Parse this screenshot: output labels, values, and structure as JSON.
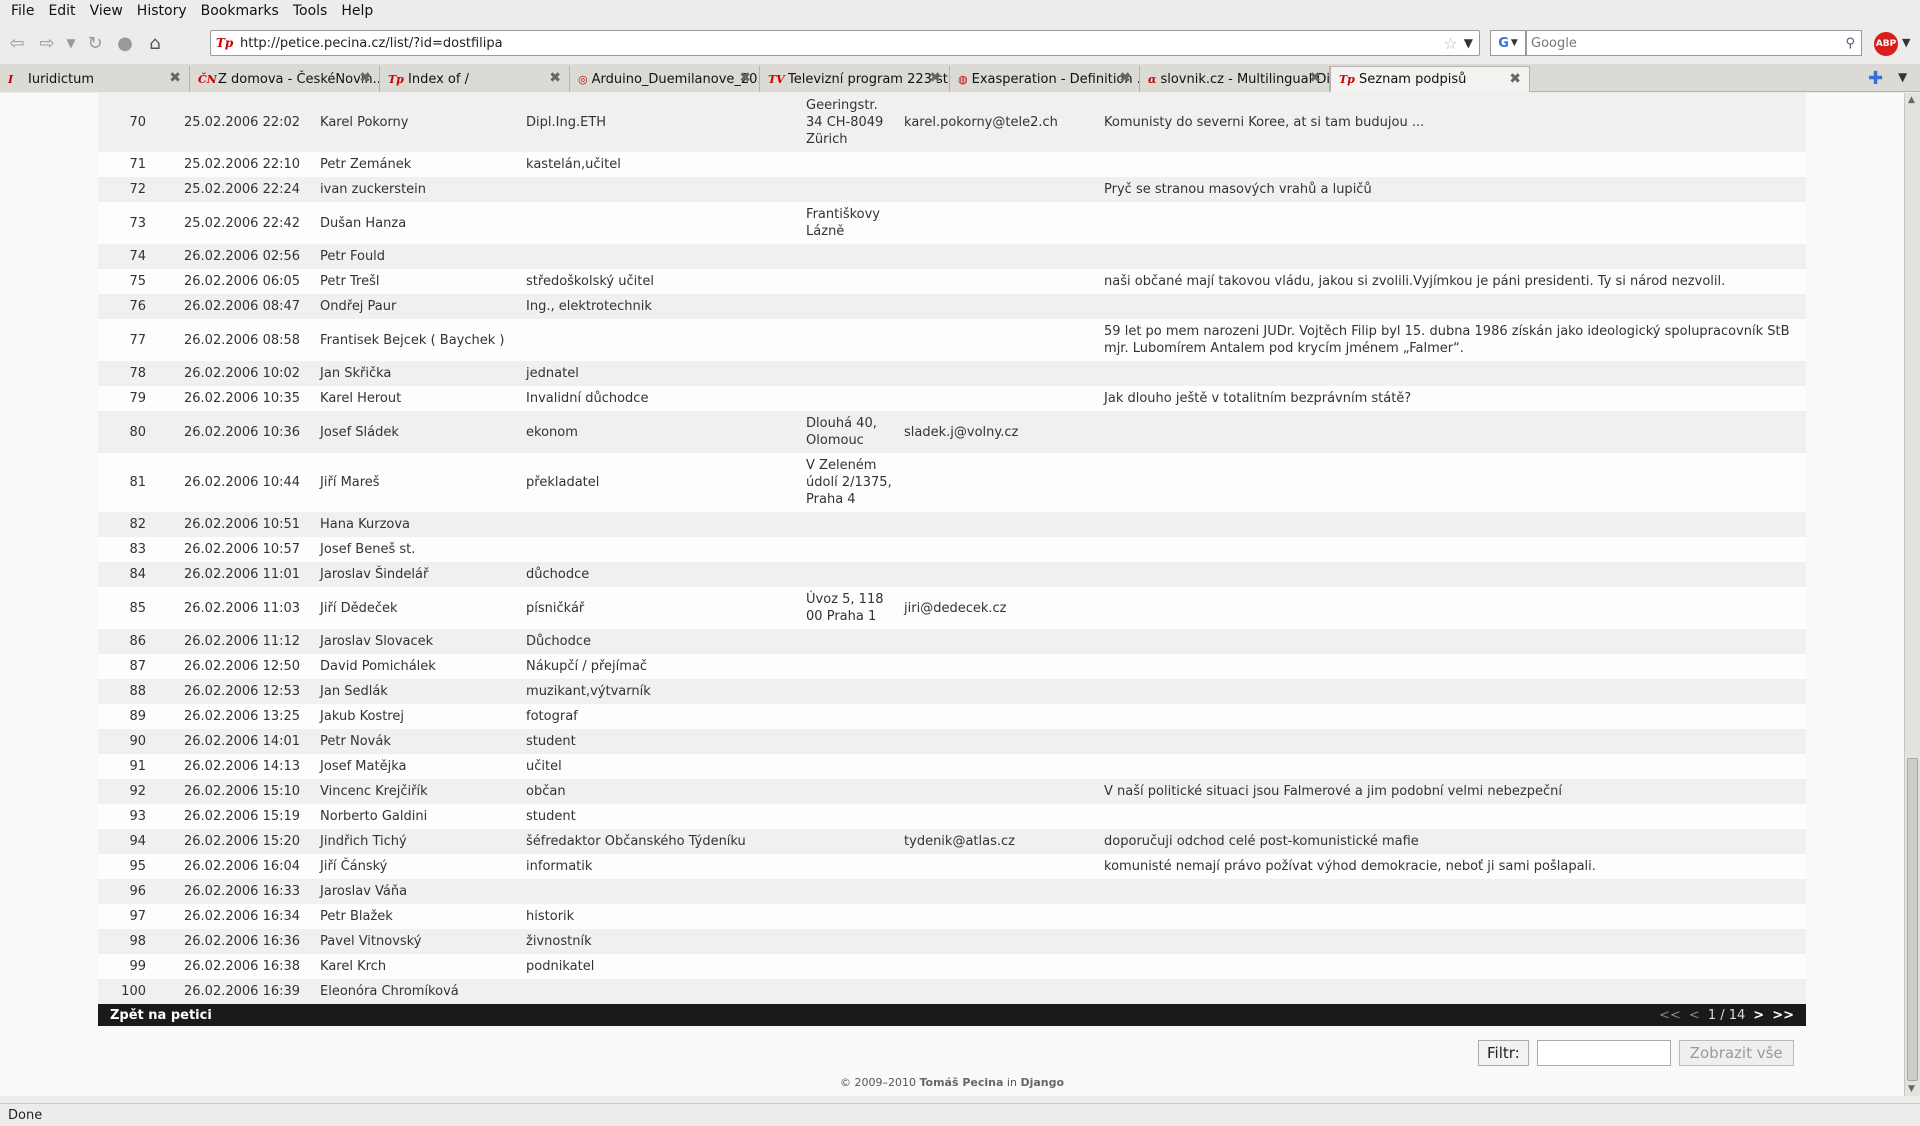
{
  "menu": [
    "File",
    "Edit",
    "View",
    "History",
    "Bookmarks",
    "Tools",
    "Help"
  ],
  "nav": {
    "url": "http://petice.pecina.cz/list/?id=dostfilipa",
    "search_placeholder": "Google",
    "abp_label": "ABP",
    "engine_label": "G"
  },
  "tabs": [
    {
      "title": "Iuridictum",
      "icon": "iuridictum-icon",
      "glyph": "I"
    },
    {
      "title": "Z domova - ČeskéNovin...",
      "icon": "ceskenoviny-icon",
      "glyph": "ČN"
    },
    {
      "title": "Index of /",
      "icon": "tp-icon",
      "glyph": "Tp"
    },
    {
      "title": "Arduino_Duemilanove_20...",
      "icon": "page-icon",
      "glyph": "◎"
    },
    {
      "title": "Televizní program 223 st...",
      "icon": "tv-icon",
      "glyph": "TV"
    },
    {
      "title": "Exasperation - Definition ...",
      "icon": "dictionary-icon",
      "glyph": "◍"
    },
    {
      "title": "slovnik.cz - Multilingual Di...",
      "icon": "slovnik-icon",
      "glyph": "α"
    },
    {
      "title": "Seznam podpisů",
      "icon": "tp-icon",
      "glyph": "Tp",
      "active": true
    }
  ],
  "rows": [
    {
      "num": "70",
      "date": "25.02.2006 22:02",
      "name": "Karel Pokorny",
      "occupation": "Dipl.Ing.ETH",
      "address": "Geeringstr. 34 CH-8049 Zürich",
      "email": "karel.pokorny@tele2.ch",
      "comment": "Komunisty do severni Koree, at si tam budujou ..."
    },
    {
      "num": "71",
      "date": "25.02.2006 22:10",
      "name": "Petr Zemánek",
      "occupation": "kastelán,učitel",
      "address": "",
      "email": "",
      "comment": ""
    },
    {
      "num": "72",
      "date": "25.02.2006 22:24",
      "name": "ivan zuckerstein",
      "occupation": "",
      "address": "",
      "email": "",
      "comment": "Pryč se stranou masových vrahů a lupičů"
    },
    {
      "num": "73",
      "date": "25.02.2006 22:42",
      "name": "Dušan Hanza",
      "occupation": "",
      "address": "Františkovy Lázně",
      "email": "",
      "comment": ""
    },
    {
      "num": "74",
      "date": "26.02.2006 02:56",
      "name": "Petr Fould",
      "occupation": "",
      "address": "",
      "email": "",
      "comment": ""
    },
    {
      "num": "75",
      "date": "26.02.2006 06:05",
      "name": "Petr Trešl",
      "occupation": "středoškolský učitel",
      "address": "",
      "email": "",
      "comment": "naši občané mají takovou vládu, jakou si zvolili.Vyjímkou je páni presidenti. Ty si národ nezvolil."
    },
    {
      "num": "76",
      "date": "26.02.2006 08:47",
      "name": "Ondřej Paur",
      "occupation": "Ing., elektrotechnik",
      "address": "",
      "email": "",
      "comment": ""
    },
    {
      "num": "77",
      "date": "26.02.2006 08:58",
      "name": "Frantisek Bejcek ( Baychek )",
      "occupation": "",
      "address": "",
      "email": "",
      "comment": "59 let po mem narozeni JUDr. Vojtěch Filip byl 15. dubna 1986 získán jako ideologický spolupracovník StB mjr. Lubomírem Antalem pod krycím jménem „Falmer“."
    },
    {
      "num": "78",
      "date": "26.02.2006 10:02",
      "name": "Jan Skřička",
      "occupation": "jednatel",
      "address": "",
      "email": "",
      "comment": ""
    },
    {
      "num": "79",
      "date": "26.02.2006 10:35",
      "name": "Karel Herout",
      "occupation": "Invalidní důchodce",
      "address": "",
      "email": "",
      "comment": "Jak dlouho ještě v totalitním bezprávním státě?"
    },
    {
      "num": "80",
      "date": "26.02.2006 10:36",
      "name": "Josef Sládek",
      "occupation": "ekonom",
      "address": "Dlouhá 40, Olomouc",
      "email": "sladek.j@volny.cz",
      "comment": ""
    },
    {
      "num": "81",
      "date": "26.02.2006 10:44",
      "name": "Jiří Mareš",
      "occupation": "překladatel",
      "address": "V Zeleném údolí 2/1375, Praha 4",
      "email": "",
      "comment": ""
    },
    {
      "num": "82",
      "date": "26.02.2006 10:51",
      "name": "Hana Kurzova",
      "occupation": "",
      "address": "",
      "email": "",
      "comment": ""
    },
    {
      "num": "83",
      "date": "26.02.2006 10:57",
      "name": "Josef Beneš st.",
      "occupation": "",
      "address": "",
      "email": "",
      "comment": ""
    },
    {
      "num": "84",
      "date": "26.02.2006 11:01",
      "name": "Jaroslav Šindelář",
      "occupation": "důchodce",
      "address": "",
      "email": "",
      "comment": ""
    },
    {
      "num": "85",
      "date": "26.02.2006 11:03",
      "name": "Jiří Dědeček",
      "occupation": "písničkář",
      "address": "Úvoz 5, 118 00 Praha 1",
      "email": "jiri@dedecek.cz",
      "comment": ""
    },
    {
      "num": "86",
      "date": "26.02.2006 11:12",
      "name": "Jaroslav Slovacek",
      "occupation": "Důchodce",
      "address": "",
      "email": "",
      "comment": ""
    },
    {
      "num": "87",
      "date": "26.02.2006 12:50",
      "name": "David Pomichálek",
      "occupation": "Nákupčí / přejímač",
      "address": "",
      "email": "",
      "comment": ""
    },
    {
      "num": "88",
      "date": "26.02.2006 12:53",
      "name": "Jan Sedlák",
      "occupation": "muzikant,výtvarník",
      "address": "",
      "email": "",
      "comment": ""
    },
    {
      "num": "89",
      "date": "26.02.2006 13:25",
      "name": "Jakub Kostrej",
      "occupation": "fotograf",
      "address": "",
      "email": "",
      "comment": ""
    },
    {
      "num": "90",
      "date": "26.02.2006 14:01",
      "name": "Petr Novák",
      "occupation": "student",
      "address": "",
      "email": "",
      "comment": ""
    },
    {
      "num": "91",
      "date": "26.02.2006 14:13",
      "name": "Josef Matějka",
      "occupation": "učitel",
      "address": "",
      "email": "",
      "comment": ""
    },
    {
      "num": "92",
      "date": "26.02.2006 15:10",
      "name": "Vincenc Krejčiřík",
      "occupation": "občan",
      "address": "",
      "email": "",
      "comment": "V naší politické situaci jsou Falmerové a jim podobní velmi nebezpeční"
    },
    {
      "num": "93",
      "date": "26.02.2006 15:19",
      "name": "Norberto Galdini",
      "occupation": "student",
      "address": "",
      "email": "",
      "comment": ""
    },
    {
      "num": "94",
      "date": "26.02.2006 15:20",
      "name": "Jindřich Tichý",
      "occupation": "šéfredaktor Občanského Týdeníku",
      "address": "",
      "email": "tydenik@atlas.cz",
      "comment": "doporučuji odchod celé post-komunistické mafie"
    },
    {
      "num": "95",
      "date": "26.02.2006 16:04",
      "name": "Jiří Čánský",
      "occupation": "informatik",
      "address": "",
      "email": "",
      "comment": "komunisté nemají právo požívat výhod demokracie, neboť ji sami pošlapali."
    },
    {
      "num": "96",
      "date": "26.02.2006 16:33",
      "name": "Jaroslav Váňa",
      "occupation": "",
      "address": "",
      "email": "",
      "comment": ""
    },
    {
      "num": "97",
      "date": "26.02.2006 16:34",
      "name": "Petr Blažek",
      "occupation": "historik",
      "address": "",
      "email": "",
      "comment": ""
    },
    {
      "num": "98",
      "date": "26.02.2006 16:36",
      "name": "Pavel Vitnovský",
      "occupation": "živnostník",
      "address": "",
      "email": "",
      "comment": ""
    },
    {
      "num": "99",
      "date": "26.02.2006 16:38",
      "name": "Karel Krch",
      "occupation": "podnikatel",
      "address": "",
      "email": "",
      "comment": ""
    },
    {
      "num": "100",
      "date": "26.02.2006 16:39",
      "name": "Eleonóra Chromíková",
      "occupation": "",
      "address": "",
      "email": "",
      "comment": ""
    }
  ],
  "footer": {
    "back_label": "Zpět na petici",
    "first": "<<",
    "prev": "<",
    "page": "1 / 14",
    "next": ">",
    "last": ">>"
  },
  "filter": {
    "label": "Filtr:",
    "value": "",
    "show_all": "Zobrazit vše"
  },
  "copyright": {
    "prefix": "© 2009–2010",
    "author": "Tomáš Pecina",
    "middle": "in",
    "framework": "Django"
  },
  "status": "Done"
}
